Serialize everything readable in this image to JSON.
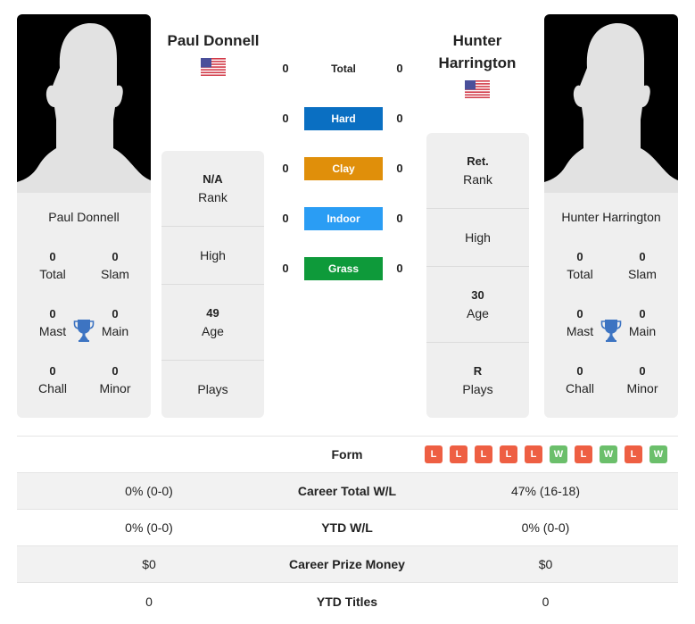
{
  "colors": {
    "hard": "#0a6fc2",
    "clay": "#e08f0a",
    "indoor": "#2a9df4",
    "grass": "#0e9a3a",
    "loss": "#ee5f43",
    "win": "#6bbf6b",
    "trophy": "#3d74c2"
  },
  "player1": {
    "name": "Paul Donnell",
    "country_flag": "usa-flag-icon",
    "card_name": "Paul Donnell",
    "titles": {
      "total": {
        "value": "0",
        "label": "Total"
      },
      "slam": {
        "value": "0",
        "label": "Slam"
      },
      "mast": {
        "value": "0",
        "label": "Mast"
      },
      "main": {
        "value": "0",
        "label": "Main"
      },
      "chall": {
        "value": "0",
        "label": "Chall"
      },
      "minor": {
        "value": "0",
        "label": "Minor"
      }
    },
    "info": {
      "rank": {
        "value": "N/A",
        "label": "Rank"
      },
      "high": {
        "value": "",
        "label": "High"
      },
      "age": {
        "value": "49",
        "label": "Age"
      },
      "plays": {
        "value": "",
        "label": "Plays"
      }
    }
  },
  "player2": {
    "name": "Hunter Harrington",
    "country_flag": "usa-flag-icon",
    "card_name": "Hunter Harrington",
    "titles": {
      "total": {
        "value": "0",
        "label": "Total"
      },
      "slam": {
        "value": "0",
        "label": "Slam"
      },
      "mast": {
        "value": "0",
        "label": "Mast"
      },
      "main": {
        "value": "0",
        "label": "Main"
      },
      "chall": {
        "value": "0",
        "label": "Chall"
      },
      "minor": {
        "value": "0",
        "label": "Minor"
      }
    },
    "info": {
      "rank": {
        "value": "Ret.",
        "label": "Rank"
      },
      "high": {
        "value": "",
        "label": "High"
      },
      "age": {
        "value": "30",
        "label": "Age"
      },
      "plays": {
        "value": "R",
        "label": "Plays"
      }
    }
  },
  "h2h": {
    "total": {
      "label": "Total",
      "p1": "0",
      "p2": "0"
    },
    "hard": {
      "label": "Hard",
      "p1": "0",
      "p2": "0"
    },
    "clay": {
      "label": "Clay",
      "p1": "0",
      "p2": "0"
    },
    "indoor": {
      "label": "Indoor",
      "p1": "0",
      "p2": "0"
    },
    "grass": {
      "label": "Grass",
      "p1": "0",
      "p2": "0"
    }
  },
  "stats": {
    "form_label": "Form",
    "form": [
      "L",
      "L",
      "L",
      "L",
      "L",
      "W",
      "L",
      "W",
      "L",
      "W"
    ],
    "rows": [
      {
        "label": "Career Total W/L",
        "p1": "0% (0-0)",
        "p2": "47% (16-18)"
      },
      {
        "label": "YTD W/L",
        "p1": "0% (0-0)",
        "p2": "0% (0-0)"
      },
      {
        "label": "Career Prize Money",
        "p1": "$0",
        "p2": "$0"
      },
      {
        "label": "YTD Titles",
        "p1": "0",
        "p2": "0"
      }
    ]
  }
}
